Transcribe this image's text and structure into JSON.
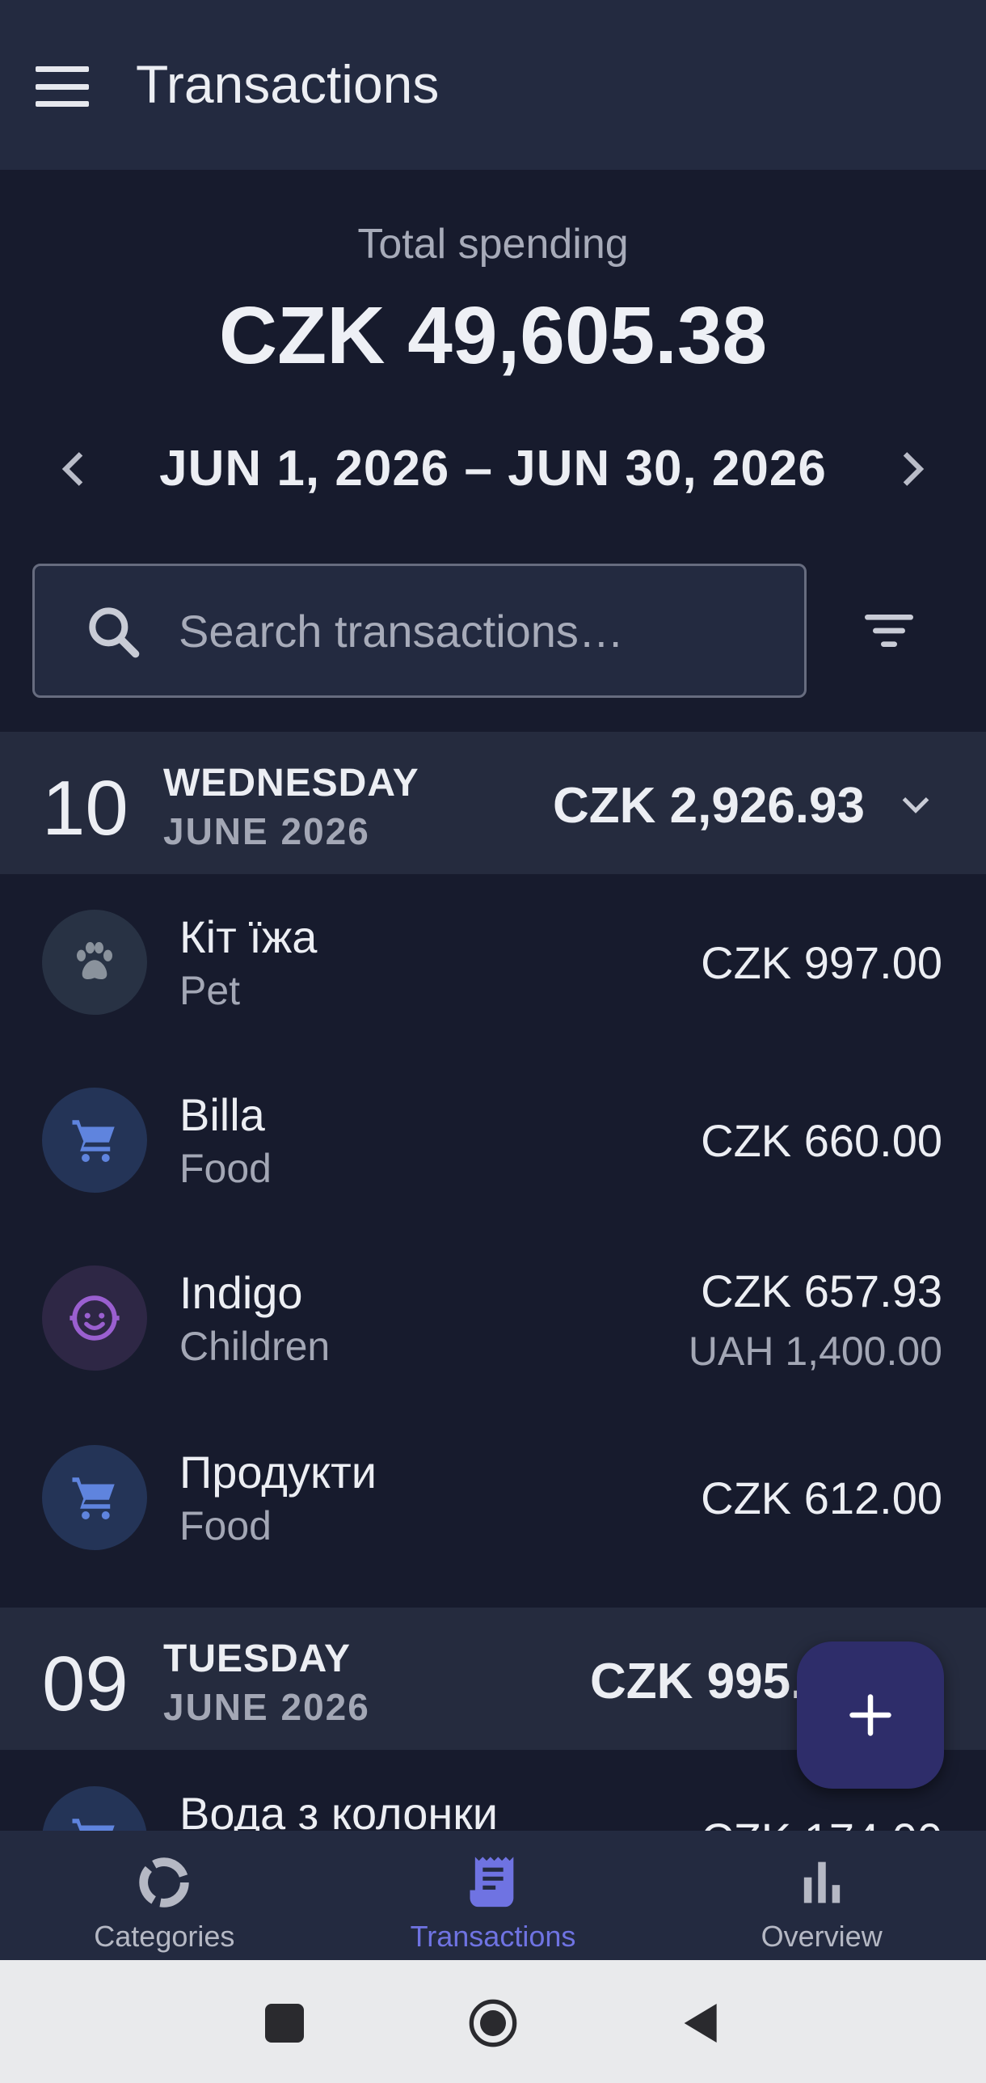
{
  "app_bar": {
    "title": "Transactions"
  },
  "summary": {
    "total_label": "Total spending",
    "total_value": "CZK 49,605.38",
    "date_range": "JUN 1, 2026 – JUN 30, 2026"
  },
  "search": {
    "placeholder": "Search transactions…",
    "value": ""
  },
  "days": [
    {
      "day": "10",
      "weekday": "WEDNESDAY",
      "month": "JUNE 2026",
      "total": "CZK 2,926.93",
      "transactions": [
        {
          "name": "Кіт їжа",
          "category": "Pet",
          "amount": "CZK 997.00",
          "icon": "paw-icon",
          "icon_color": "#8a929c",
          "avatar_bg": "#283244"
        },
        {
          "name": "Billa",
          "category": "Food",
          "amount": "CZK 660.00",
          "icon": "cart-icon",
          "icon_color": "#5f84de",
          "avatar_bg": "#243457"
        },
        {
          "name": "Indigo",
          "category": "Children",
          "amount": "CZK 657.93",
          "amount_secondary": "UAH 1,400.00",
          "icon": "baby-face-icon",
          "icon_color": "#9a5fd0",
          "avatar_bg": "#2e2745"
        },
        {
          "name": "Продукти",
          "category": "Food",
          "amount": "CZK 612.00",
          "icon": "cart-icon",
          "icon_color": "#5f84de",
          "avatar_bg": "#243457"
        }
      ]
    },
    {
      "day": "09",
      "weekday": "TUESDAY",
      "month": "JUNE 2026",
      "total": "CZK 995.",
      "transactions": [
        {
          "name": "Вода з колонки",
          "category": "",
          "amount": "CZK 174.00",
          "icon": "cart-icon",
          "icon_color": "#5f84de",
          "avatar_bg": "#243457"
        }
      ]
    }
  ],
  "fab": {
    "icon": "plus-icon"
  },
  "bottom_nav": [
    {
      "label": "Categories",
      "icon": "donut-icon",
      "active": false
    },
    {
      "label": "Transactions",
      "icon": "receipt-icon",
      "active": true
    },
    {
      "label": "Overview",
      "icon": "bar-chart-icon",
      "active": false
    }
  ],
  "system_nav": {
    "recents": "square-icon",
    "home": "circle-icon",
    "back": "triangle-back-icon"
  },
  "colors": {
    "accent": "#6f73e2",
    "background": "#171b2d",
    "surface": "#232a40",
    "fab": "#2e2d6a"
  }
}
